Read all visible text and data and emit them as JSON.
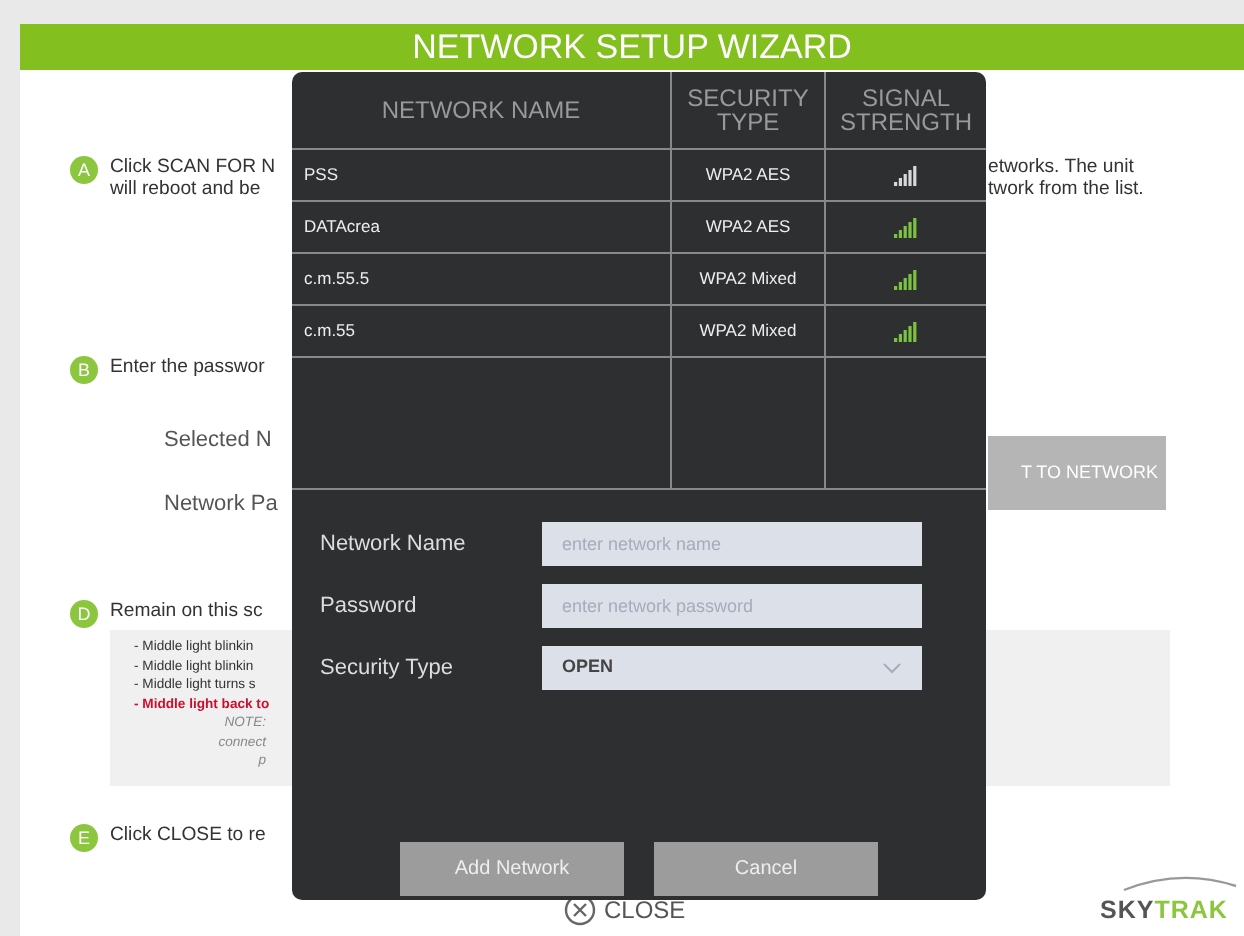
{
  "header": {
    "title": "NETWORK SETUP WIZARD"
  },
  "step_a": {
    "badge": "A",
    "lines": [
      "Click SCAN FOR N",
      "will reboot and be"
    ],
    "right_lines": [
      "etworks. The unit",
      "twork from the list."
    ]
  },
  "step_b": {
    "badge": "B",
    "text": "Enter the passwor"
  },
  "fields": [
    {
      "label": "Selected N"
    },
    {
      "label": "Network Pa"
    }
  ],
  "connect_button": "T TO NETWORK",
  "step_d": {
    "badge": "D",
    "text": "Remain on this sc"
  },
  "status_lines": [
    {
      "kind": "normal",
      "text": "- Middle light blinkin"
    },
    {
      "kind": "normal",
      "text": "- Middle light blinkin"
    },
    {
      "kind": "normal",
      "text": "- Middle light turns s"
    },
    {
      "kind": "alert",
      "text": "- Middle light back to"
    },
    {
      "kind": "note",
      "text": "NOTE:"
    },
    {
      "kind": "note",
      "text": "connect"
    },
    {
      "kind": "note",
      "text": "p"
    }
  ],
  "step_e": {
    "badge": "E",
    "text": "Click CLOSE to re"
  },
  "close_link": "CLOSE",
  "logo": {
    "first": "SKY",
    "second": "TRAK"
  },
  "modal": {
    "columns": [
      "NETWORK NAME",
      "SECURITY TYPE",
      "SIGNAL STRENGTH"
    ],
    "networks": [
      {
        "name": "PSS",
        "security": "WPA2 AES",
        "color": "#d8d8d8"
      },
      {
        "name": "DATAcrea",
        "security": "WPA2 AES",
        "color": "#7cc242"
      },
      {
        "name": "c.m.55.5",
        "security": "WPA2 Mixed",
        "color": "#7cc242"
      },
      {
        "name": "c.m.55",
        "security": "WPA2 Mixed",
        "color": "#7cc242"
      }
    ],
    "form": [
      {
        "kind": "text",
        "label": "Network Name",
        "placeholder": "enter network name"
      },
      {
        "kind": "text",
        "label": "Password",
        "placeholder": "enter network password"
      },
      {
        "kind": "select",
        "label": "Security Type",
        "value": "OPEN"
      }
    ],
    "buttons": [
      "Add Network",
      "Cancel"
    ]
  }
}
